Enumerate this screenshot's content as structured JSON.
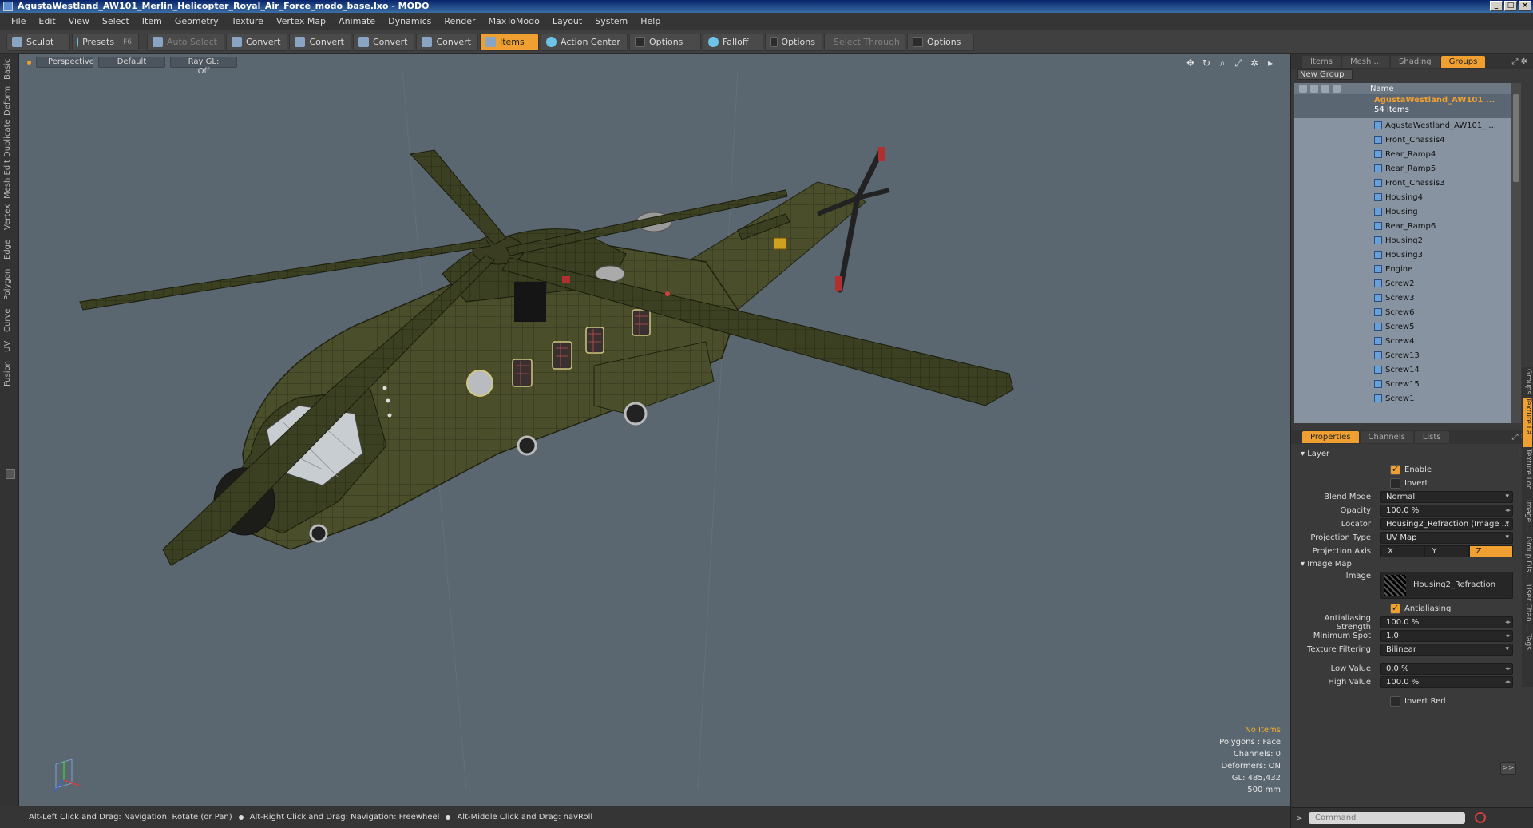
{
  "window": {
    "title": "AgustaWestland_AW101_Merlin_Helicopter_Royal_Air_Force_modo_base.lxo - MODO"
  },
  "menu": [
    "File",
    "Edit",
    "View",
    "Select",
    "Item",
    "Geometry",
    "Texture",
    "Vertex Map",
    "Animate",
    "Dynamics",
    "Render",
    "MaxToModo",
    "Layout",
    "System",
    "Help"
  ],
  "toolbar": {
    "sculpt": "Sculpt",
    "presets": "Presets",
    "presets_key": "F6",
    "auto_select": "Auto Select",
    "convert": "Convert",
    "items": "Items",
    "action_center": "Action Center",
    "options": "Options",
    "falloff": "Falloff",
    "select_through": "Select Through"
  },
  "left_tabs": [
    "Basic",
    "Deform",
    "Duplicate",
    "Mesh Edit",
    "Vertex",
    "Edge",
    "Polygon",
    "Curve",
    "UV",
    "Fusion"
  ],
  "viewport": {
    "view": "Perspective",
    "style": "Default",
    "render": "Ray GL: Off",
    "stats": {
      "items": "No Items",
      "polygons": "Polygons : Face",
      "channels": "Channels: 0",
      "deformers": "Deformers: ON",
      "gl": "GL: 485,432",
      "scale": "500 mm"
    }
  },
  "status": {
    "hint1": "Alt-Left Click and Drag: Navigation: Rotate (or Pan)",
    "hint2": "Alt-Right Click and Drag: Navigation: Freewheel",
    "hint3": "Alt-Middle Click and Drag: navRoll"
  },
  "outliner": {
    "tabs": [
      "Items",
      "Mesh ...",
      "Shading",
      "Groups"
    ],
    "active_tab": "Groups",
    "new_group": "New Group",
    "name_col": "Name",
    "group_name": "AgustaWestland_AW101 ...",
    "group_count": "54 Items",
    "items": [
      "AgustaWestland_AW101_ ...",
      "Front_Chassis4",
      "Rear_Ramp4",
      "Rear_Ramp5",
      "Front_Chassis3",
      "Housing4",
      "Housing",
      "Rear_Ramp6",
      "Housing2",
      "Housing3",
      "Engine",
      "Screw2",
      "Screw3",
      "Screw6",
      "Screw5",
      "Screw4",
      "Screw13",
      "Screw14",
      "Screw15",
      "Screw1"
    ]
  },
  "properties": {
    "tabs": [
      "Properties",
      "Channels",
      "Lists"
    ],
    "layer_section": "Layer",
    "enable": "Enable",
    "invert": "Invert",
    "blend_mode_label": "Blend Mode",
    "blend_mode": "Normal",
    "opacity_label": "Opacity",
    "opacity": "100.0 %",
    "locator_label": "Locator",
    "locator": "Housing2_Refraction (Image ...",
    "projection_type_label": "Projection Type",
    "projection_type": "UV Map",
    "projection_axis_label": "Projection Axis",
    "axes": [
      "X",
      "Y",
      "Z"
    ],
    "image_map_section": "Image Map",
    "image_label": "Image",
    "image": "Housing2_Refraction",
    "antialiasing": "Antialiasing",
    "aa_strength_label": "Antialiasing Strength",
    "aa_strength": "100.0 %",
    "min_spot_label": "Minimum Spot",
    "min_spot": "1.0",
    "tex_filter_label": "Texture Filtering",
    "tex_filter": "Bilinear",
    "low_value_label": "Low Value",
    "low_value": "0.0 %",
    "high_value_label": "High Value",
    "high_value": "100.0 %",
    "invert_red": "Invert Red",
    "expand": ">>"
  },
  "right_vtabs": [
    "Groups",
    "Texture La ...",
    "Texture Loc ...",
    "Image ...",
    "Group Dis ...",
    "User Chan ...",
    "Tags"
  ],
  "command": {
    "placeholder": "Command"
  }
}
